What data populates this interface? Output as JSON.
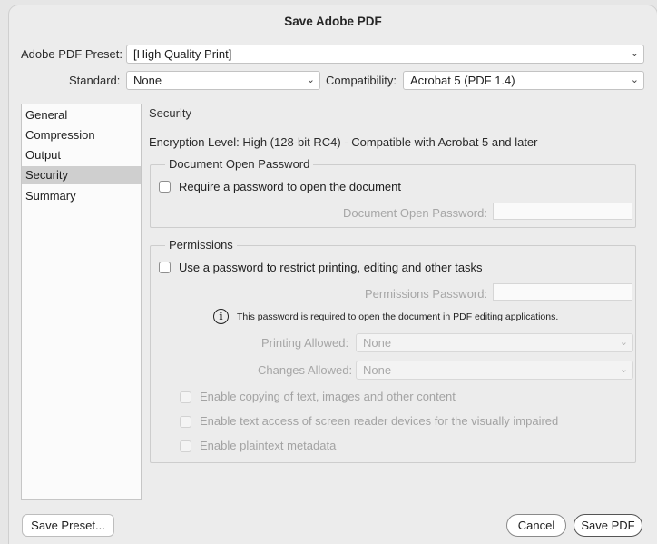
{
  "window": {
    "title": "Save Adobe PDF"
  },
  "preset": {
    "label": "Adobe PDF Preset:",
    "value": "[High Quality Print]"
  },
  "standard": {
    "label": "Standard:",
    "value": "None"
  },
  "compatibility": {
    "label": "Compatibility:",
    "value": "Acrobat 5 (PDF 1.4)"
  },
  "sidebar": {
    "items": [
      {
        "label": "General"
      },
      {
        "label": "Compression"
      },
      {
        "label": "Output"
      },
      {
        "label": "Security"
      },
      {
        "label": "Summary"
      }
    ],
    "selected": "Security"
  },
  "security": {
    "title": "Security",
    "encryption_text": "Encryption Level: High (128-bit RC4) - Compatible with Acrobat 5 and later",
    "open_password_group": {
      "title": "Document Open Password",
      "checkbox_label": "Require a password to open the document",
      "checked": false,
      "field_label": "Document Open Password:",
      "field_value": ""
    },
    "permissions_group": {
      "title": "Permissions",
      "checkbox_label": "Use a password to restrict printing, editing and other tasks",
      "checked": false,
      "field_label": "Permissions Password:",
      "field_value": "",
      "info_text": "This password is required to open the document in PDF editing applications.",
      "printing_label": "Printing Allowed:",
      "printing_value": "None",
      "changes_label": "Changes Allowed:",
      "changes_value": "None",
      "options": [
        {
          "label": "Enable copying of text, images and other content",
          "checked": false
        },
        {
          "label": "Enable text access of screen reader devices for the visually impaired",
          "checked": false
        },
        {
          "label": "Enable plaintext metadata",
          "checked": false
        }
      ]
    }
  },
  "buttons": {
    "save_preset": "Save Preset...",
    "cancel": "Cancel",
    "save_pdf": "Save PDF"
  },
  "icons": {
    "chevron": "chevron-down-icon",
    "info": "info-icon"
  }
}
